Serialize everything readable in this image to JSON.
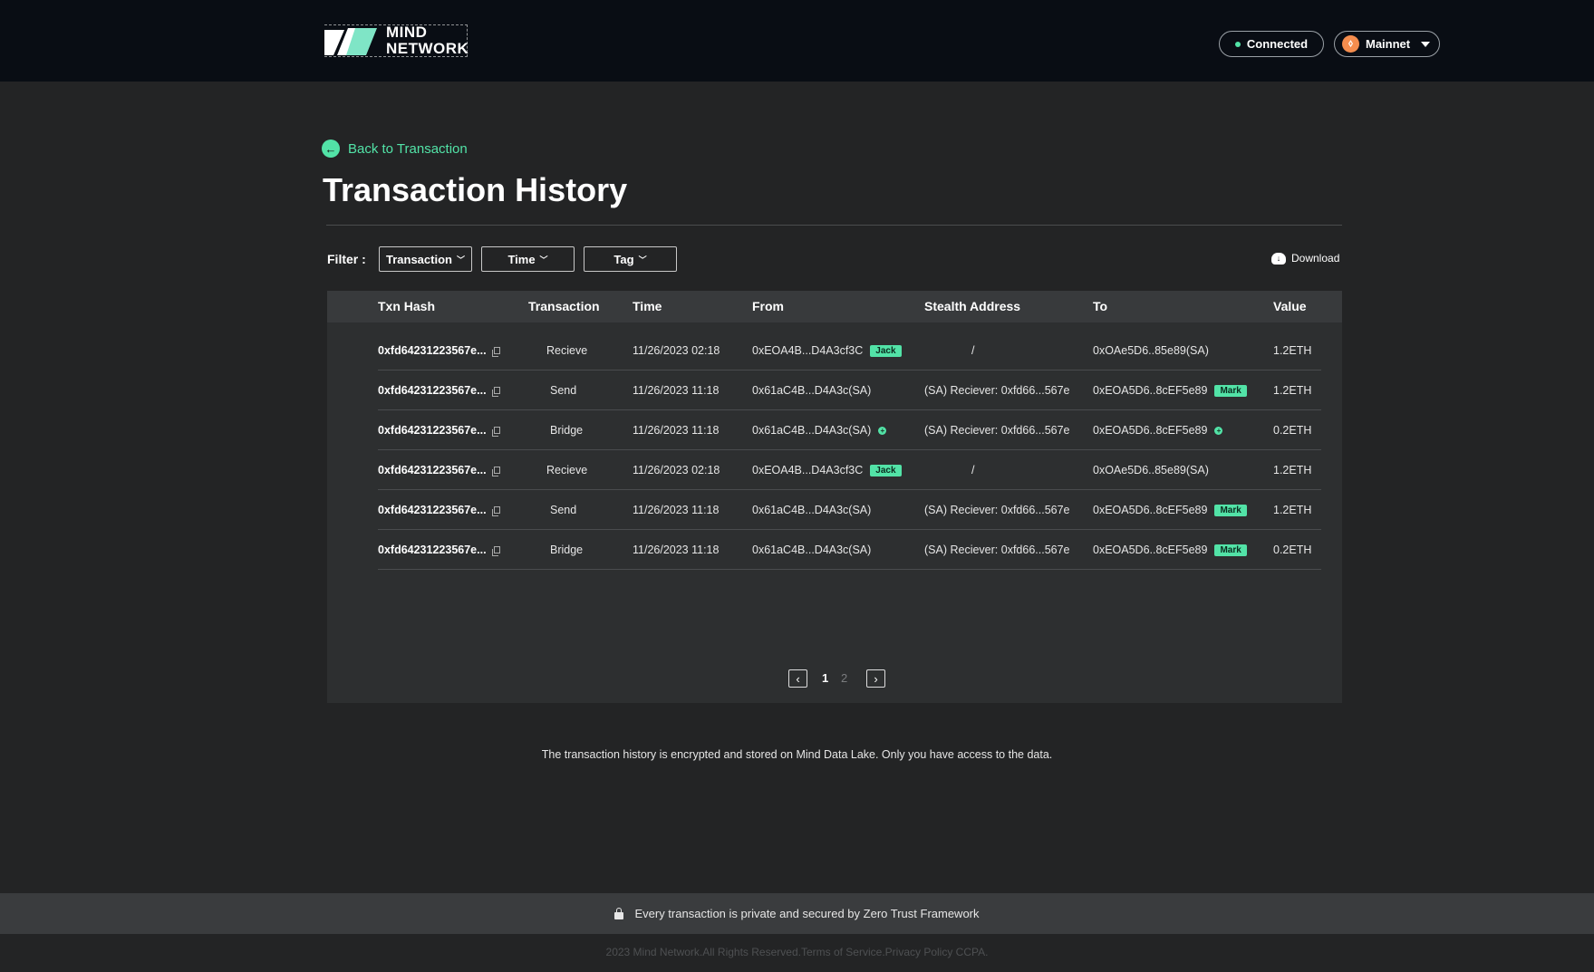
{
  "brand": {
    "line1": "MIND",
    "line2": "NETWORK"
  },
  "header": {
    "connected_label": "Connected",
    "network_label": "Mainnet"
  },
  "nav": {
    "back_label": "Back to Transaction"
  },
  "page": {
    "title": "Transaction History"
  },
  "filters": {
    "label": "Filter :",
    "transaction": "Transaction",
    "time": "Time",
    "tag": "Tag",
    "download": "Download"
  },
  "table": {
    "headers": {
      "hash": "Txn Hash",
      "transaction": "Transaction",
      "time": "Time",
      "from": "From",
      "stealth": "Stealth Address",
      "to": "To",
      "value": "Value"
    },
    "rows": [
      {
        "hash": "0xfd64231223567e...",
        "transaction": "Recieve",
        "time": "11/26/2023 02:18",
        "from": "0xEOA4B...D4A3cf3C",
        "stealth": "/",
        "to": "0xOAe5D6..85e89(SA)",
        "value": "1.2ETH"
      },
      {
        "hash": "0xfd64231223567e...",
        "transaction": "Send",
        "time": "11/26/2023 11:18",
        "from": "0x61aC4B...D4A3c(SA)",
        "stealth": "(SA) Reciever: 0xfd66...567e",
        "to": "0xEOA5D6..8cEF5e89",
        "value": "1.2ETH"
      },
      {
        "hash": "0xfd64231223567e...",
        "transaction": "Bridge",
        "time": "11/26/2023 11:18",
        "from": "0x61aC4B...D4A3c(SA)",
        "stealth": "(SA) Reciever: 0xfd66...567e",
        "to": "0xEOA5D6..8cEF5e89",
        "value": "0.2ETH"
      },
      {
        "hash": "0xfd64231223567e...",
        "transaction": "Recieve",
        "time": "11/26/2023 02:18",
        "from": "0xEOA4B...D4A3cf3C",
        "stealth": "/",
        "to": "0xOAe5D6..85e89(SA)",
        "value": "1.2ETH"
      },
      {
        "hash": "0xfd64231223567e...",
        "transaction": "Send",
        "time": "11/26/2023 11:18",
        "from": "0x61aC4B...D4A3c(SA)",
        "stealth": "(SA) Reciever: 0xfd66...567e",
        "to": "0xEOA5D6..8cEF5e89",
        "value": "1.2ETH"
      },
      {
        "hash": "0xfd64231223567e...",
        "transaction": "Bridge",
        "time": "11/26/2023 11:18",
        "from": "0x61aC4B...D4A3c(SA)",
        "stealth": "(SA) Reciever: 0xfd66...567e",
        "to": "0xEOA5D6..8cEF5e89",
        "value": "0.2ETH"
      }
    ],
    "tags": {
      "jack": "Jack",
      "mark": "Mark"
    }
  },
  "pagination": {
    "page1": "1",
    "page2": "2"
  },
  "footer": {
    "note": "The transaction history is encrypted and stored on Mind Data Lake. Only you have access to the data.",
    "secure": "Every transaction is private and secured by Zero Trust Framework",
    "copyright": "2023 Mind Network.All Rights Reserved.Terms of Service.Privacy Policy CCPA."
  },
  "colors": {
    "accent": "#52e3a7",
    "topbar": "#090d14",
    "background": "#232425",
    "panel": "#2d2f30"
  }
}
